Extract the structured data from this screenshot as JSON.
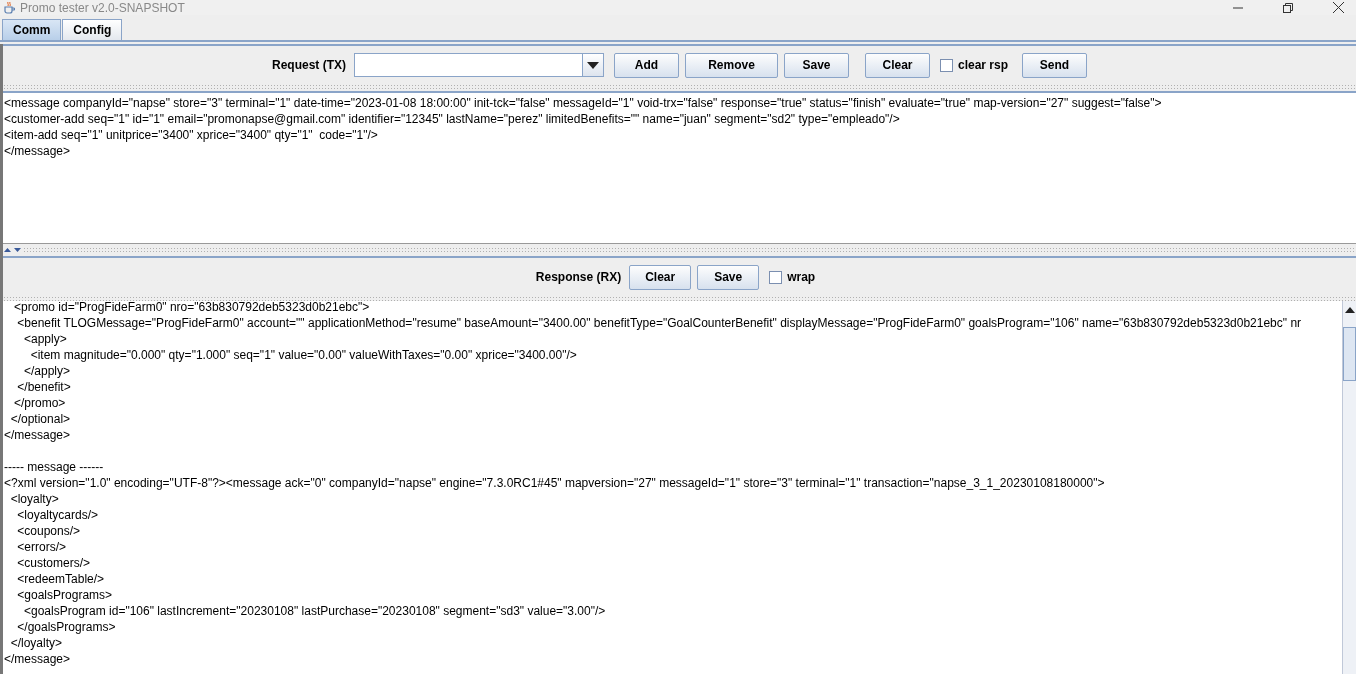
{
  "window": {
    "title": "Promo tester v2.0-SNAPSHOT"
  },
  "tabs": [
    {
      "label": "Comm",
      "selected": true
    },
    {
      "label": "Config",
      "selected": false
    }
  ],
  "request_toolbar": {
    "label": "Request (TX)",
    "buttons_left": [
      "Add",
      "Remove",
      "Save"
    ],
    "clear_button": "Clear",
    "clear_rsp": {
      "label": "clear rsp",
      "checked": false
    },
    "send_button": "Send"
  },
  "request_lines": [
    "<message companyId=\"napse\" store=\"3\" terminal=\"1\" date-time=\"2023-01-08 18:00:00\" init-tck=\"false\" messageId=\"1\" void-trx=\"false\" response=\"true\" status=\"finish\" evaluate=\"true\" map-version=\"27\" suggest=\"false\">",
    "<customer-add seq=\"1\" id=\"1\" email=\"promonapse@gmail.com\" identifier=\"12345\" lastName=\"perez\" limitedBenefits=\"\" name=\"juan\" segment=\"sd2\" type=\"empleado\"/>",
    "<item-add seq=\"1\" unitprice=\"3400\" xprice=\"3400\" qty=\"1\"  code=\"1\"/>",
    "</message>"
  ],
  "response_toolbar": {
    "label": "Response (RX)",
    "buttons": [
      "Clear",
      "Save"
    ],
    "wrap": {
      "label": "wrap",
      "checked": false
    }
  },
  "response_blocks": [
    [
      "   <promo id=\"ProgFideFarm0\" nro=\"63b830792deb5323d0b21ebc\">",
      "    <benefit TLOGMessage=\"ProgFideFarm0\" account=\"\" applicationMethod=\"resume\" baseAmount=\"3400.00\" benefitType=\"GoalCounterBenefit\" displayMessage=\"ProgFideFarm0\" goalsProgram=\"106\" name=\"63b830792deb5323d0b21ebc\" nr",
      "      <apply>",
      "        <item magnitude=\"0.000\" qty=\"1.000\" seq=\"1\" value=\"0.00\" valueWithTaxes=\"0.00\" xprice=\"3400.00\"/>",
      "      </apply>",
      "    </benefit>",
      "   </promo>",
      "  </optional>",
      "</message>"
    ],
    [
      "----- message ------",
      "<?xml version=\"1.0\" encoding=\"UTF-8\"?><message ack=\"0\" companyId=\"napse\" engine=\"7.3.0RC1#45\" mapversion=\"27\" messageId=\"1\" store=\"3\" terminal=\"1\" transaction=\"napse_3_1_20230108180000\">",
      "  <loyalty>",
      "    <loyaltycards/>",
      "    <coupons/>",
      "    <errors/>",
      "    <customers/>",
      "    <redeemTable/>",
      "    <goalsPrograms>",
      "      <goalsProgram id=\"106\" lastIncrement=\"20230108\" lastPurchase=\"20230108\" segment=\"sd3\" value=\"3.00\"/>",
      "    </goalsPrograms>",
      "  </loyalty>",
      "</message>"
    ]
  ]
}
